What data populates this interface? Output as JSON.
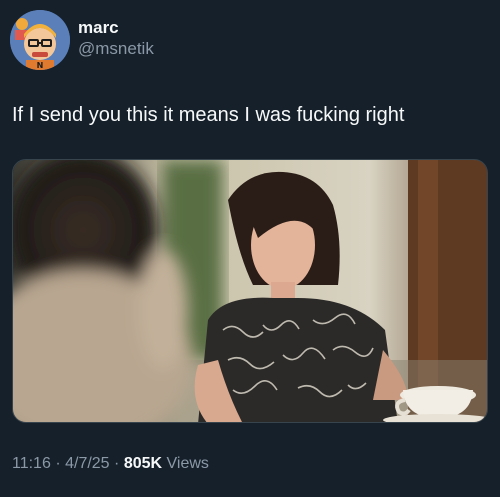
{
  "author": {
    "display_name": "marc",
    "handle": "@msnetik"
  },
  "tweet": {
    "text": "If I send you this it means I was fucking right"
  },
  "meta": {
    "time": "11:16",
    "separator_1": "·",
    "date": "4/7/25",
    "separator_2": "·",
    "views_count": "805K",
    "views_label": "Views"
  },
  "colors": {
    "background": "#15202b",
    "primary_text": "#f7f9f9",
    "secondary_text": "#8b98a5"
  },
  "icons": {
    "avatar": "cartoon-avatar-icon"
  }
}
